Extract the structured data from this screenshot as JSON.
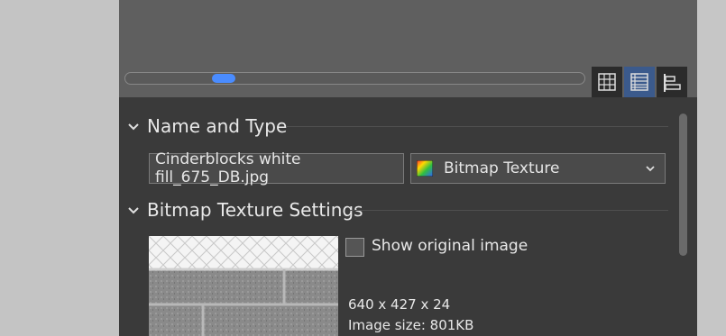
{
  "sections": {
    "name_and_type": {
      "title": "Name and Type"
    },
    "bitmap_settings": {
      "title": "Bitmap Texture Settings"
    }
  },
  "name_field": {
    "value": "Cinderblocks white fill_675_DB.jpg"
  },
  "type_select": {
    "value": "Bitmap Texture",
    "icon": "bitmap-texture-icon"
  },
  "show_original": {
    "label": "Show original image",
    "checked": false
  },
  "image_info": {
    "dimensions": "640 x 427 x 24",
    "size": "Image size: 801KB"
  },
  "view_buttons": [
    "grid-view-icon",
    "list-view-icon",
    "details-view-icon"
  ],
  "colors": {
    "accent": "#4a8cff",
    "panel": "#3a3a3a",
    "selected": "#3b5a8c"
  }
}
